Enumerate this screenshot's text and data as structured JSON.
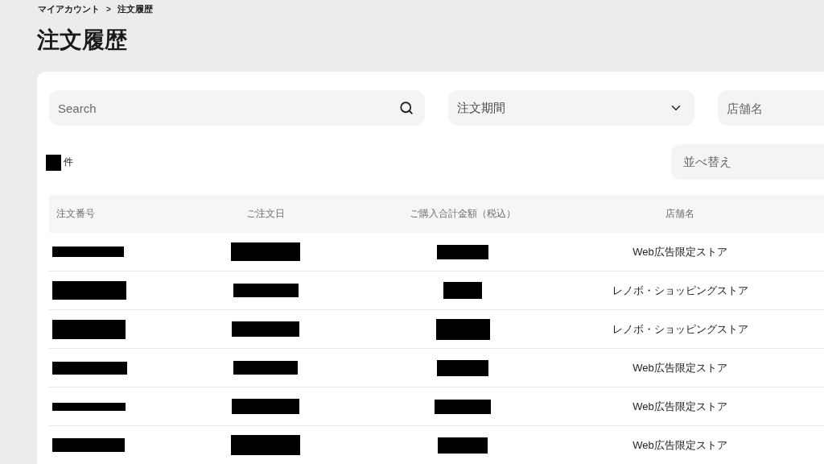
{
  "breadcrumb": {
    "items": [
      "マイアカウント",
      "注文履歴"
    ],
    "separator": ">"
  },
  "page_title": "注文履歴",
  "filters": {
    "search": {
      "placeholder": "Search"
    },
    "period": {
      "label": "注文期間"
    },
    "store": {
      "placeholder": "店舗名"
    }
  },
  "result_count": {
    "count_redacted": true,
    "unit": "件"
  },
  "sort": {
    "label": "並べ替え"
  },
  "table": {
    "columns": [
      "注文番号",
      "ご注文日",
      "ご購入合計金額（税込）",
      "店舗名"
    ],
    "rows": [
      {
        "order_number_redacted": true,
        "order_date_redacted": true,
        "total_redacted": true,
        "store": "Web広告限定ストア"
      },
      {
        "order_number_redacted": true,
        "order_date_redacted": true,
        "total_redacted": true,
        "store": "レノボ・ショッピングストア"
      },
      {
        "order_number_redacted": true,
        "order_date_redacted": true,
        "total_redacted": true,
        "store": "レノボ・ショッピングストア"
      },
      {
        "order_number_redacted": true,
        "order_date_redacted": true,
        "total_redacted": true,
        "store": "Web広告限定ストア"
      },
      {
        "order_number_redacted": true,
        "order_date_redacted": true,
        "total_redacted": true,
        "store": "Web広告限定ストア"
      },
      {
        "order_number_redacted": true,
        "order_date_redacted": true,
        "total_redacted": true,
        "store": "Web広告限定ストア"
      }
    ]
  }
}
